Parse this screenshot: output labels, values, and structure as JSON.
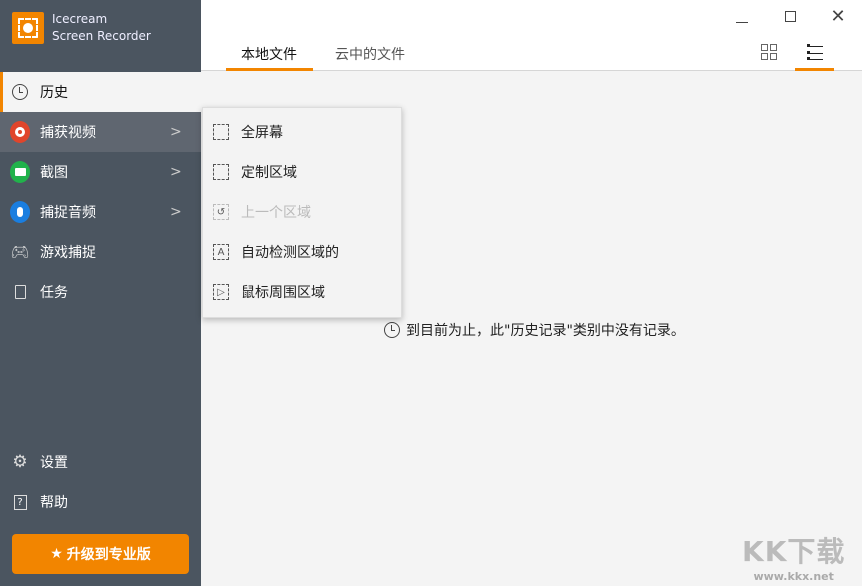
{
  "app": {
    "name_line1": "Icecream",
    "name_line2": "Screen Recorder"
  },
  "sidebar": {
    "items": [
      {
        "label": "历史",
        "icon": "clock-icon"
      },
      {
        "label": "捕获视频",
        "icon": "record-icon",
        "color": "#e0452b"
      },
      {
        "label": "截图",
        "icon": "camera-icon",
        "color": "#21b24b"
      },
      {
        "label": "捕捉音频",
        "icon": "microphone-icon",
        "color": "#1a7ee0"
      },
      {
        "label": "游戏捕捉",
        "icon": "gamepad-icon"
      },
      {
        "label": "任务",
        "icon": "task-icon"
      }
    ],
    "bottom": [
      {
        "label": "设置",
        "icon": "gear-icon"
      },
      {
        "label": "帮助",
        "icon": "help-icon"
      }
    ],
    "upgrade": "升级到专业版"
  },
  "header": {
    "tabs": [
      "本地文件",
      "云中的文件"
    ]
  },
  "menu": {
    "items": [
      {
        "label": "全屏幕",
        "disabled": false
      },
      {
        "label": "定制区域",
        "disabled": false
      },
      {
        "label": "上一个区域",
        "disabled": true
      },
      {
        "label": "自动检测区域的",
        "disabled": false
      },
      {
        "label": "鼠标周围区域",
        "disabled": false
      }
    ]
  },
  "empty_message": "到目前为止，此\"历史记录\"类别中没有记录。",
  "watermark": {
    "line1": "KK下载",
    "line2": "www.kkx.net"
  },
  "colors": {
    "accent": "#f28500",
    "sidebar": "#4b5560"
  }
}
